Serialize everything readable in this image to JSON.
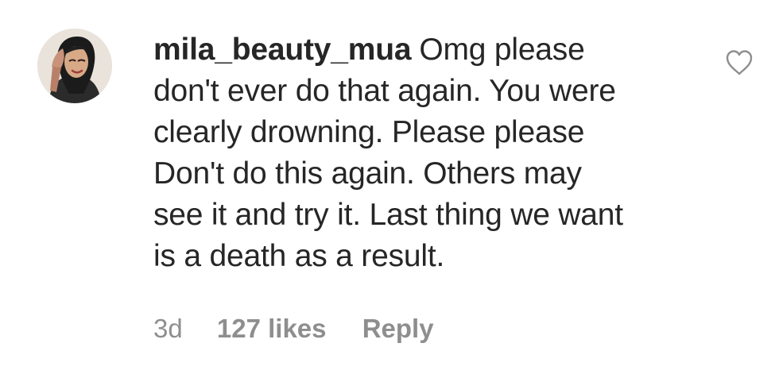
{
  "comment": {
    "username": "mila_beauty_mua",
    "text_lines": [
      "Omg please",
      "don't ever do that again. You were",
      "clearly drowning. Please please",
      "Don't do this again. Others may",
      "see it and try it. Last thing we want",
      "is a death as a result."
    ],
    "time": "3d",
    "likes": "127 likes",
    "reply_label": "Reply",
    "like_icon": "heart-outline-icon",
    "avatar_icon": "user-avatar"
  },
  "colors": {
    "text": "#262626",
    "muted": "#8e8e8e",
    "icon_stroke": "#8e8e8e",
    "background": "#ffffff"
  }
}
